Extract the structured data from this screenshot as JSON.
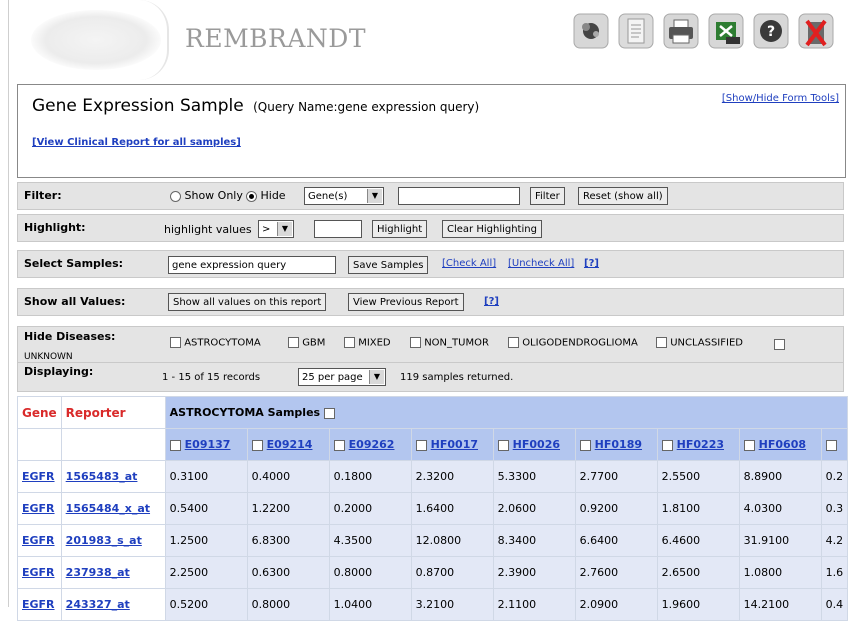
{
  "app": {
    "brand": "REMBRANDT"
  },
  "toolbar_icons": [
    "graph-icon",
    "document-icon",
    "printer-icon",
    "excel-export-icon",
    "help-icon",
    "close-trash-icon"
  ],
  "title_box": {
    "title": "Gene Expression Sample",
    "query_name": "(Query Name:gene expression query)",
    "toggle_link": "[Show/Hide Form Tools]",
    "clinical_link": "[View Clinical Report for all samples]"
  },
  "filter": {
    "label": "Filter:",
    "show_only_label": "Show Only",
    "hide_label": "Hide",
    "type_value": "Gene(s)",
    "text_value": "",
    "filter_button": "Filter",
    "reset_button": "Reset (show all)"
  },
  "highlight": {
    "label": "Highlight:",
    "prefix": "highlight values",
    "operator": ">",
    "value": "",
    "highlight_button": "Highlight",
    "clear_button": "Clear Highlighting"
  },
  "select_samples": {
    "label": "Select Samples:",
    "input_value": "gene expression query",
    "save_button": "Save Samples",
    "check_all": "[Check All]",
    "uncheck_all": "[Uncheck All]",
    "help": "[?]"
  },
  "show_all_values": {
    "label": "Show all Values:",
    "show_button": "Show all values on this report",
    "prev_button": "View Previous Report",
    "help": "[?]"
  },
  "hide_diseases": {
    "label": "Hide Diseases:",
    "options": [
      "ASTROCYTOMA",
      "GBM",
      "MIXED",
      "NON_TUMOR",
      "OLIGODENDROGLIOMA",
      "UNCLASSIFIED",
      "UNKNOWN"
    ]
  },
  "displaying": {
    "label": "Displaying:",
    "range": "1 - 15 of 15 records",
    "per_page": "25 per page",
    "returned": "119 samples returned."
  },
  "table": {
    "gene_header": "Gene",
    "reporter_header": "Reporter",
    "group_header": "ASTROCYTOMA Samples",
    "samples": [
      "E09137",
      "E09214",
      "E09262",
      "HF0017",
      "HF0026",
      "HF0189",
      "HF0223",
      "HF0608",
      ""
    ],
    "rows": [
      {
        "gene": "EGFR",
        "reporter": "1565483_at",
        "values": [
          "0.3100",
          "0.4000",
          "0.1800",
          "2.3200",
          "5.3300",
          "2.7700",
          "2.5500",
          "8.8900",
          "0.2"
        ]
      },
      {
        "gene": "EGFR",
        "reporter": "1565484_x_at",
        "values": [
          "0.5400",
          "1.2200",
          "0.2000",
          "1.6400",
          "2.0600",
          "0.9200",
          "1.8100",
          "4.0300",
          "0.3"
        ]
      },
      {
        "gene": "EGFR",
        "reporter": "201983_s_at",
        "values": [
          "1.2500",
          "6.8300",
          "4.3500",
          "12.0800",
          "8.3400",
          "6.6400",
          "6.4600",
          "31.9100",
          "4.2"
        ]
      },
      {
        "gene": "EGFR",
        "reporter": "237938_at",
        "values": [
          "2.2500",
          "0.6300",
          "0.8000",
          "0.8700",
          "2.3900",
          "2.7600",
          "2.6500",
          "1.0800",
          "1.6"
        ]
      },
      {
        "gene": "EGFR",
        "reporter": "243327_at",
        "values": [
          "0.5200",
          "0.8000",
          "1.0400",
          "3.2100",
          "2.1100",
          "2.0900",
          "1.9600",
          "14.2100",
          "0.4"
        ]
      }
    ]
  }
}
